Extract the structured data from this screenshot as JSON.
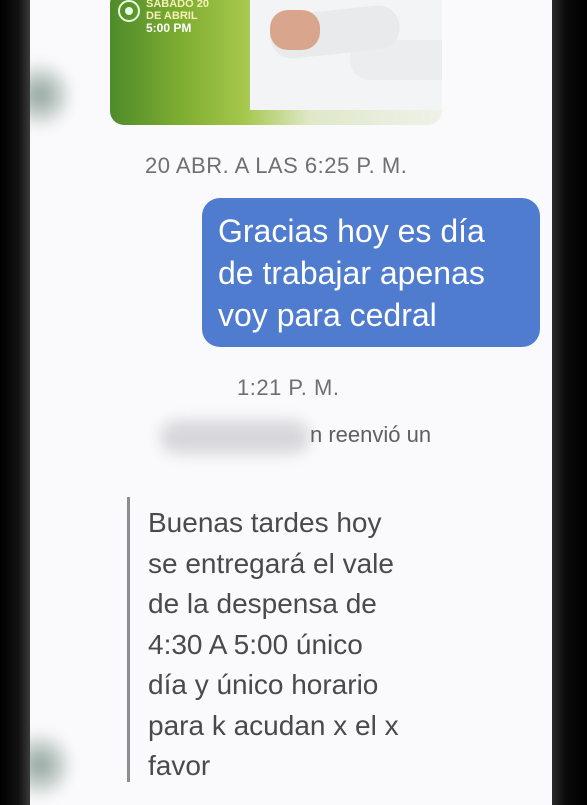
{
  "image_preview": {
    "event_lines": [
      "SÁBADO 20",
      "DE ABRIL",
      "5:00 PM"
    ]
  },
  "messages": {
    "date_separator": "20 ABR. A LAS 6:25 P. M.",
    "outgoing_lines": [
      "Gracias hoy es día",
      "de trabajar apenas",
      "voy para cedral"
    ],
    "time_label": "1:21 P. M.",
    "forward_notice": "n reenvió un",
    "forwarded_lines": [
      "Buenas tardes hoy",
      "se entregará el vale",
      "de la despensa de",
      "4:30 A 5:00 único",
      "día y único horario",
      "para k acudan x el x",
      "favor"
    ]
  },
  "colors": {
    "outgoing_bubble": "#4f7ccf",
    "background": "#fafafc",
    "forward_bar": "#8d8d91"
  }
}
